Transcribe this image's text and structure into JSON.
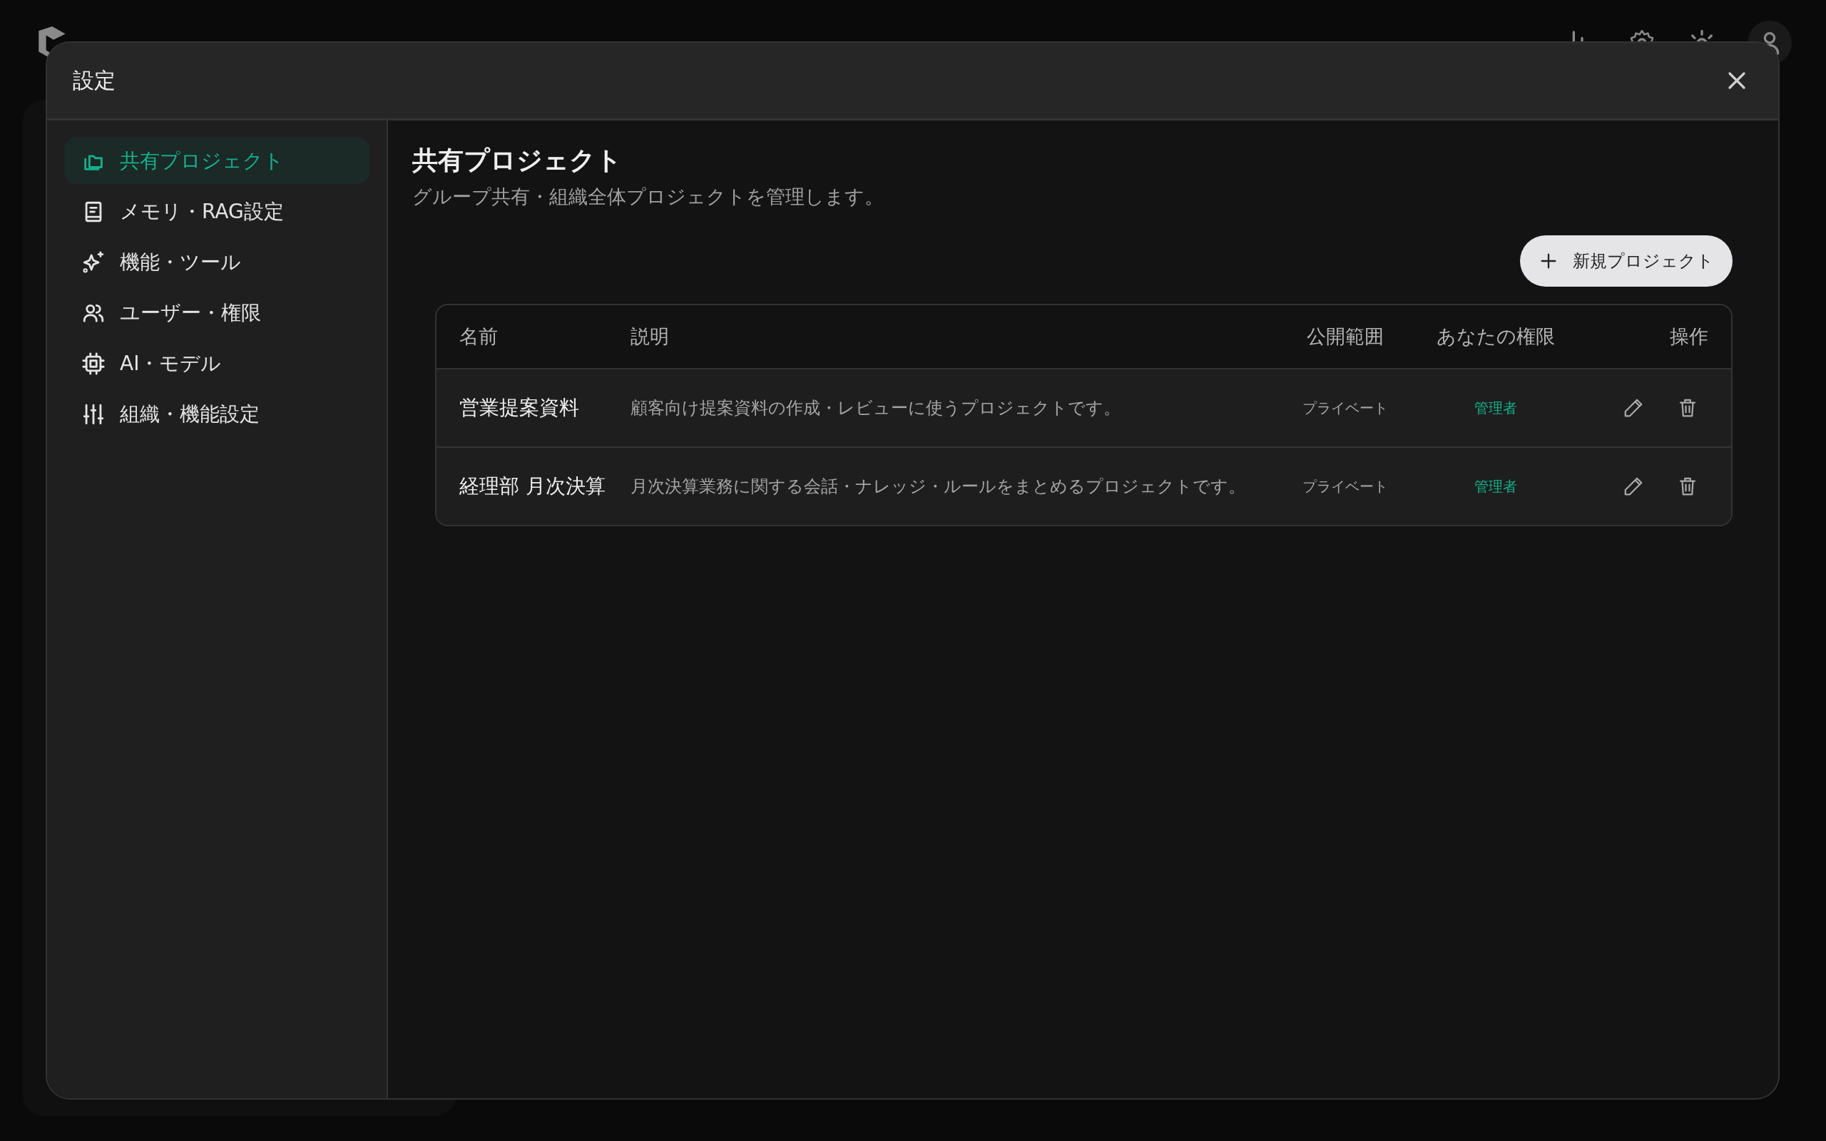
{
  "dialog": {
    "title": "設定"
  },
  "sidebar": {
    "items": [
      {
        "label": "共有プロジェクト",
        "selected": true
      },
      {
        "label": "メモリ・RAG設定",
        "selected": false
      },
      {
        "label": "機能・ツール",
        "selected": false
      },
      {
        "label": "ユーザー・権限",
        "selected": false
      },
      {
        "label": "AI・モデル",
        "selected": false
      },
      {
        "label": "組織・機能設定",
        "selected": false
      }
    ]
  },
  "section": {
    "title": "共有プロジェクト",
    "subtitle": "グループ共有・組織全体プロジェクトを管理します。"
  },
  "new_button": {
    "label": "新規プロジェクト"
  },
  "table": {
    "columns": [
      "名前",
      "説明",
      "公開範囲",
      "あなたの権限",
      "操作"
    ],
    "rows": [
      {
        "name": "営業提案資料",
        "description": "顧客向け提案資料の作成・レビューに使うプロジェクトです。",
        "visibility": "プライベート",
        "role": "管理者"
      },
      {
        "name": "経理部 月次決算",
        "description": "月次決算業務に関する会話・ナレッジ・ルールをまとめるプロジェクトです。",
        "visibility": "プライベート",
        "role": "管理者"
      }
    ]
  }
}
